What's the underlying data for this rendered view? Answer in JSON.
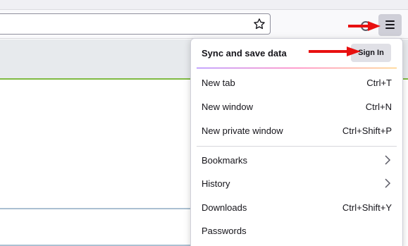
{
  "toolbar": {
    "star_icon": "star-icon",
    "menu_icon": "hamburger-menu-icon"
  },
  "appmenu": {
    "sync_title": "Sync and save data",
    "signin_label": "Sign In",
    "items": [
      {
        "label": "New tab",
        "shortcut": "Ctrl+T"
      },
      {
        "label": "New window",
        "shortcut": "Ctrl+N"
      },
      {
        "label": "New private window",
        "shortcut": "Ctrl+Shift+P"
      },
      {
        "label": "Bookmarks",
        "shortcut": ""
      },
      {
        "label": "History",
        "shortcut": ""
      },
      {
        "label": "Downloads",
        "shortcut": "Ctrl+Shift+Y"
      },
      {
        "label": "Passwords",
        "shortcut": ""
      }
    ]
  },
  "colors": {
    "annotation_arrow": "#e81010",
    "accent_green": "#7fba42"
  }
}
